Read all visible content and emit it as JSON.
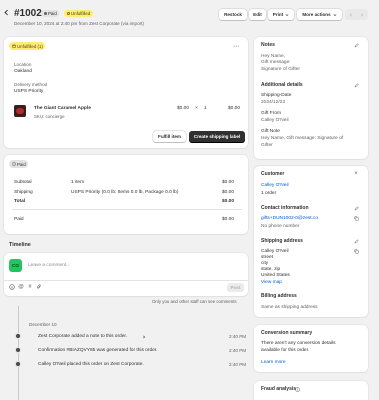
{
  "header": {
    "order_number": "#1002",
    "payment_badge": "Paid",
    "fulfillment_badge": "Unfulfilled",
    "subtitle": "December 10, 2024 at 2:40 pm from Zest Corporate (via import)",
    "restock_label": "Restock",
    "edit_label": "Edit",
    "print_label": "Print",
    "more_actions_label": "More actions"
  },
  "unfulfilled": {
    "badge": "Unfulfilled (1)",
    "location_label": "Location",
    "location_value": "Oakland",
    "delivery_label": "Delivery method",
    "delivery_value": "USPS Priority",
    "item_name": "The Giant Caramel Apple",
    "item_sku": "SKU: concierge",
    "item_price": "$0.00",
    "item_times": "×",
    "item_qty": "1",
    "item_total": "$0.00",
    "fulfill_label": "Fulfill item",
    "shipping_label_btn": "Create shipping label"
  },
  "payment": {
    "badge": "Paid",
    "rows": [
      {
        "label": "Subtotal",
        "detail": "1 item",
        "value": "$0.00"
      },
      {
        "label": "Shipping",
        "detail": "USPS Priority (0.0 lb: Items 0.0 lb, Package 0.0 lb)",
        "value": "$0.00"
      },
      {
        "label": "Total",
        "detail": "",
        "value": "$0.00"
      }
    ],
    "paid_label": "Paid",
    "paid_value": "$0.00"
  },
  "timeline": {
    "title": "Timeline",
    "avatar_initials": "CO",
    "comment_placeholder": "Leave a comment...",
    "post_label": "Post",
    "visibility_note": "Only you and other staff can see comments",
    "date": "December 10",
    "events": [
      {
        "text": "Zest Corporate added a note to this order.",
        "time": "2:40 PM"
      },
      {
        "text": "Confirmation #BIAZQVY85 was generated for this order.",
        "time": "2:40 PM"
      },
      {
        "text": "Calley O'Neil placed this order on Zest Corporate.",
        "time": "2:40 PM"
      }
    ]
  },
  "notes": {
    "title": "Notes",
    "lines": [
      "Hey Name,",
      "Gift message:",
      "Signature of Gifter"
    ],
    "additional_title": "Additional details",
    "details": [
      {
        "label": "Shipping-Date",
        "value": "2024/12/23"
      },
      {
        "label": "Gift From",
        "value": "Calley O'Neil"
      },
      {
        "label": "Gift Note",
        "value": "Hey Name, Gift message: Signature of"
      },
      {
        "label": "",
        "value": "Gifter"
      }
    ]
  },
  "customer": {
    "title": "Customer",
    "name": "Calley O'Neil",
    "orders": "1 order",
    "contact_title": "Contact information",
    "email": "gifts+DUN1002-0@zest.co",
    "phone": "No phone number",
    "shipping_title": "Shipping address",
    "address": [
      "Calley O'Neil",
      "street",
      "city",
      "state, zip",
      "United States"
    ],
    "view_map": "View map",
    "billing_title": "Billing address",
    "billing_value": "Same as shipping address"
  },
  "conversion": {
    "title": "Conversion summary",
    "text_line1": "There aren't any conversion details",
    "text_line2": "available for this order.",
    "learn_more": "Learn more"
  },
  "fraud": {
    "title": "Fraud analysis"
  },
  "colors": {
    "unfulfilled_badge_bg": "#ffeb78",
    "paid_badge_bg": "#e3e3e3",
    "avatar_bg": "#22c55e",
    "primary_button": "#303030",
    "link": "#005bd3"
  }
}
